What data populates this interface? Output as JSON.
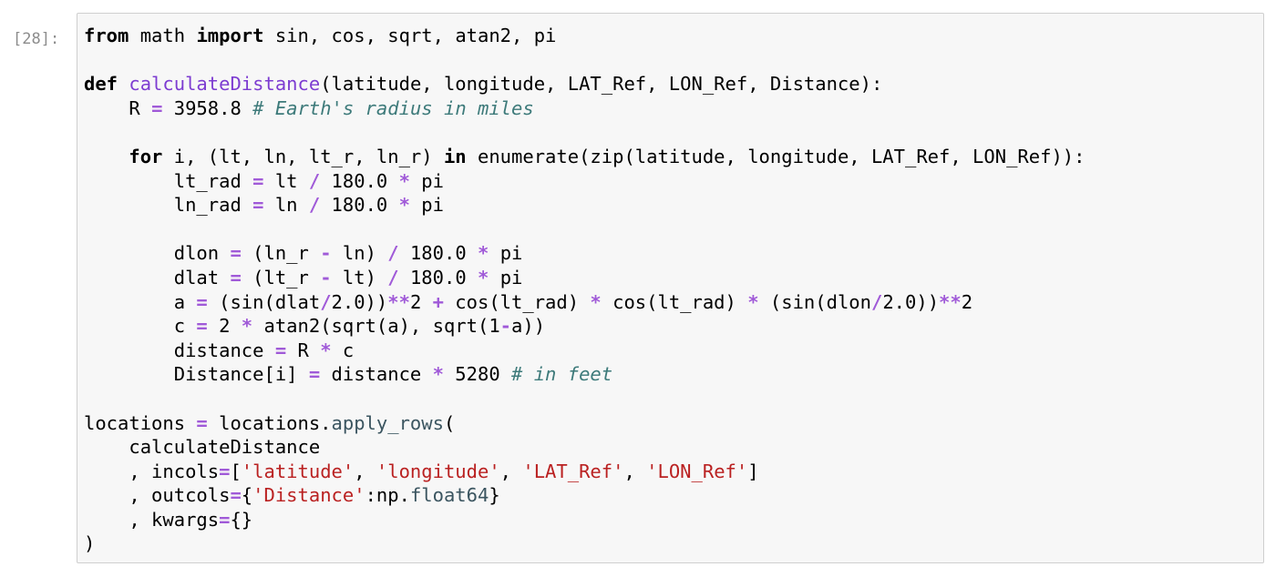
{
  "cell": {
    "prompt": "[28]:",
    "language": "python"
  },
  "colors": {
    "editor_background": "#f7f7f7",
    "editor_border": "#cfcfcf",
    "prompt": "#8c8c8c",
    "keyword": "#000000",
    "function_name": "#7d3cd1",
    "operator": "#a05ad8",
    "comment": "#3d7a7a",
    "string": "#ba2121"
  },
  "code": {
    "lines": [
      [
        {
          "t": "from",
          "c": "kw2"
        },
        {
          "t": " math ",
          "c": ""
        },
        {
          "t": "import",
          "c": "kw2"
        },
        {
          "t": " sin, cos, sqrt, atan2, pi",
          "c": ""
        }
      ],
      [],
      [
        {
          "t": "def",
          "c": "kw2"
        },
        {
          "t": " ",
          "c": ""
        },
        {
          "t": "calculateDistance",
          "c": "fn"
        },
        {
          "t": "(latitude, longitude, LAT_Ref, LON_Ref, Distance):",
          "c": ""
        }
      ],
      [
        {
          "t": "    R ",
          "c": ""
        },
        {
          "t": "=",
          "c": "op"
        },
        {
          "t": " 3958.8 ",
          "c": ""
        },
        {
          "t": "# Earth's radius in miles",
          "c": "cm"
        }
      ],
      [],
      [
        {
          "t": "    ",
          "c": ""
        },
        {
          "t": "for",
          "c": "kw2"
        },
        {
          "t": " i, (lt, ln, lt_r, ln_r) ",
          "c": ""
        },
        {
          "t": "in",
          "c": "kw2"
        },
        {
          "t": " enumerate(zip(latitude, longitude, LAT_Ref, LON_Ref)):",
          "c": ""
        }
      ],
      [
        {
          "t": "        lt_rad ",
          "c": ""
        },
        {
          "t": "=",
          "c": "op"
        },
        {
          "t": " lt ",
          "c": ""
        },
        {
          "t": "/",
          "c": "op"
        },
        {
          "t": " 180.0 ",
          "c": ""
        },
        {
          "t": "*",
          "c": "op"
        },
        {
          "t": " pi",
          "c": ""
        }
      ],
      [
        {
          "t": "        ln_rad ",
          "c": ""
        },
        {
          "t": "=",
          "c": "op"
        },
        {
          "t": " ln ",
          "c": ""
        },
        {
          "t": "/",
          "c": "op"
        },
        {
          "t": " 180.0 ",
          "c": ""
        },
        {
          "t": "*",
          "c": "op"
        },
        {
          "t": " pi",
          "c": ""
        }
      ],
      [],
      [
        {
          "t": "        dlon ",
          "c": ""
        },
        {
          "t": "=",
          "c": "op"
        },
        {
          "t": " (ln_r ",
          "c": ""
        },
        {
          "t": "-",
          "c": "op"
        },
        {
          "t": " ln) ",
          "c": ""
        },
        {
          "t": "/",
          "c": "op"
        },
        {
          "t": " 180.0 ",
          "c": ""
        },
        {
          "t": "*",
          "c": "op"
        },
        {
          "t": " pi",
          "c": ""
        }
      ],
      [
        {
          "t": "        dlat ",
          "c": ""
        },
        {
          "t": "=",
          "c": "op"
        },
        {
          "t": " (lt_r ",
          "c": ""
        },
        {
          "t": "-",
          "c": "op"
        },
        {
          "t": " lt) ",
          "c": ""
        },
        {
          "t": "/",
          "c": "op"
        },
        {
          "t": " 180.0 ",
          "c": ""
        },
        {
          "t": "*",
          "c": "op"
        },
        {
          "t": " pi",
          "c": ""
        }
      ],
      [
        {
          "t": "        a ",
          "c": ""
        },
        {
          "t": "=",
          "c": "op"
        },
        {
          "t": " (sin(dlat",
          "c": ""
        },
        {
          "t": "/",
          "c": "op"
        },
        {
          "t": "2.0))",
          "c": ""
        },
        {
          "t": "**",
          "c": "op"
        },
        {
          "t": "2 ",
          "c": ""
        },
        {
          "t": "+",
          "c": "op"
        },
        {
          "t": " cos(lt_rad) ",
          "c": ""
        },
        {
          "t": "*",
          "c": "op"
        },
        {
          "t": " cos(lt_rad) ",
          "c": ""
        },
        {
          "t": "*",
          "c": "op"
        },
        {
          "t": " (sin(dlon",
          "c": ""
        },
        {
          "t": "/",
          "c": "op"
        },
        {
          "t": "2.0))",
          "c": ""
        },
        {
          "t": "**",
          "c": "op"
        },
        {
          "t": "2",
          "c": ""
        }
      ],
      [
        {
          "t": "        c ",
          "c": ""
        },
        {
          "t": "=",
          "c": "op"
        },
        {
          "t": " 2 ",
          "c": ""
        },
        {
          "t": "*",
          "c": "op"
        },
        {
          "t": " atan2(sqrt(a), sqrt(1",
          "c": ""
        },
        {
          "t": "-",
          "c": "op"
        },
        {
          "t": "a))",
          "c": ""
        }
      ],
      [
        {
          "t": "        distance ",
          "c": ""
        },
        {
          "t": "=",
          "c": "op"
        },
        {
          "t": " R ",
          "c": ""
        },
        {
          "t": "*",
          "c": "op"
        },
        {
          "t": " c",
          "c": ""
        }
      ],
      [
        {
          "t": "        Distance[i] ",
          "c": ""
        },
        {
          "t": "=",
          "c": "op"
        },
        {
          "t": " distance ",
          "c": ""
        },
        {
          "t": "*",
          "c": "op"
        },
        {
          "t": " 5280 ",
          "c": ""
        },
        {
          "t": "# in feet",
          "c": "cm"
        }
      ],
      [],
      [
        {
          "t": "locations ",
          "c": ""
        },
        {
          "t": "=",
          "c": "op"
        },
        {
          "t": " locations.",
          "c": ""
        },
        {
          "t": "apply_rows",
          "c": "attr"
        },
        {
          "t": "(",
          "c": ""
        }
      ],
      [
        {
          "t": "    calculateDistance",
          "c": ""
        }
      ],
      [
        {
          "t": "    , incols",
          "c": ""
        },
        {
          "t": "=",
          "c": "op"
        },
        {
          "t": "[",
          "c": ""
        },
        {
          "t": "'latitude'",
          "c": "str"
        },
        {
          "t": ", ",
          "c": ""
        },
        {
          "t": "'longitude'",
          "c": "str"
        },
        {
          "t": ", ",
          "c": ""
        },
        {
          "t": "'LAT_Ref'",
          "c": "str"
        },
        {
          "t": ", ",
          "c": ""
        },
        {
          "t": "'LON_Ref'",
          "c": "str"
        },
        {
          "t": "]",
          "c": ""
        }
      ],
      [
        {
          "t": "    , outcols",
          "c": ""
        },
        {
          "t": "=",
          "c": "op"
        },
        {
          "t": "{",
          "c": ""
        },
        {
          "t": "'Distance'",
          "c": "str"
        },
        {
          "t": ":np.",
          "c": ""
        },
        {
          "t": "float64",
          "c": "attr"
        },
        {
          "t": "}",
          "c": ""
        }
      ],
      [
        {
          "t": "    , kwargs",
          "c": ""
        },
        {
          "t": "=",
          "c": "op"
        },
        {
          "t": "{}",
          "c": ""
        }
      ],
      [
        {
          "t": ")",
          "c": ""
        }
      ]
    ]
  }
}
